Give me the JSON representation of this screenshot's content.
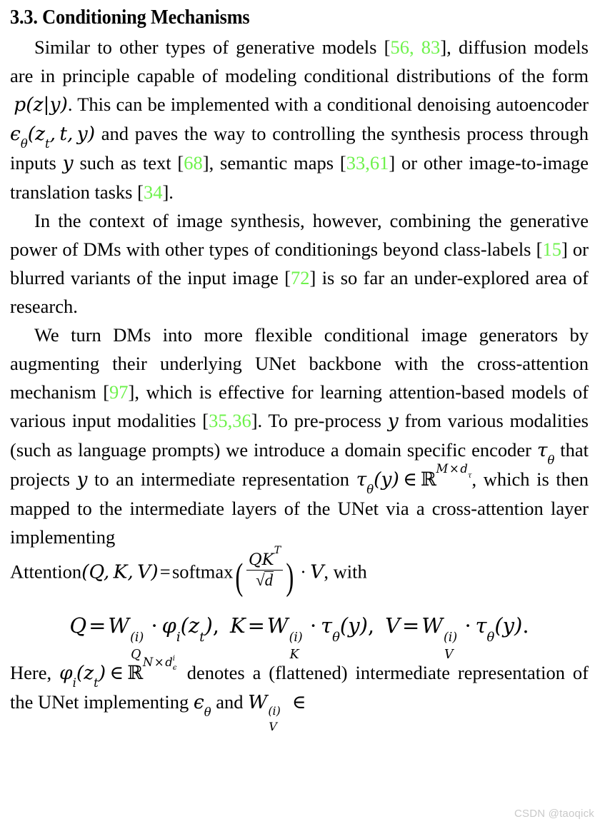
{
  "document": {
    "type": "academic-paper-excerpt",
    "background_color": "#ffffff",
    "text_color": "#000000",
    "citation_color": "#6EF24C"
  },
  "section": {
    "number": "3.3.",
    "title": "3.3. Conditioning Mechanisms"
  },
  "paragraphs": {
    "p1": {
      "s1": "Similar to other types of generative models [",
      "c1": "56, 83",
      "s2": "], diffusion models are in principle capable of modeling conditional distributions of the form ",
      "m1": "p(z|y)",
      "s3": ". This can be implemented with a conditional denoising autoencoder ",
      "m2": "ϵθ(zt, t, y)",
      "s4": " and paves the way to controlling the synthesis process through inputs ",
      "m3": "y",
      "s5": " such as text [",
      "c2": "68",
      "s6": "], semantic maps [",
      "c3": "33",
      "s7": ",",
      "c4": "61",
      "s8": "] or other image-to-image translation tasks [",
      "c5": "34",
      "s9": "]."
    },
    "p2": {
      "s1": "In the context of image synthesis, however, combining the generative power of DMs with other types of conditionings beyond class-labels [",
      "c1": "15",
      "s2": "] or blurred variants of the input image [",
      "c2": "72",
      "s3": "] is so far an under-explored area of research."
    },
    "p3": {
      "s1": "We turn DMs into more flexible conditional image generators by augmenting their underlying UNet backbone with the cross-attention mechanism [",
      "c1": "97",
      "s2": "], which is effective for learning attention-based models of various input modalities [",
      "c2": "35",
      "s3": ",",
      "c3": "36",
      "s4": "]. To pre-process ",
      "m1": "y",
      "s5": " from various modalities (such as language prompts) we introduce a domain specific encoder ",
      "m2": "τθ",
      "s6": " that projects ",
      "m3": "y",
      "s7": " to an intermediate representation ",
      "m4": "τθ(y) ∈ ℝ^{M×dτ}",
      "s8": ", which is then mapped to the intermediate layers of the UNet via a cross-attention layer implementing"
    },
    "p4": {
      "s1": "Here, ",
      "m1": "φi(zt) ∈ ℝ^{N×dϵ^i}",
      "s2": " denotes a (flattened) intermediate representation of the UNet implementing ",
      "m2": "ϵθ",
      "s3": " and ",
      "m3": "WV^(i)",
      "s4": " ∈"
    }
  },
  "math": {
    "attention_line": {
      "label": "Attention",
      "args": "(Q, K, V)",
      "equals": "=",
      "softmax": "softmax",
      "numerator": "QK",
      "numerator_sup": "T",
      "denominator_radicand": "d",
      "dot": "·",
      "result": "V",
      "trailing": ", with"
    },
    "display_equation": {
      "q_lhs": "Q",
      "q_eq": "=",
      "q_w": "W",
      "q_sup": "(i)",
      "q_sub": "Q",
      "q_dot": "·",
      "q_rhs": "φi(zt)",
      "sep1": ",",
      "k_lhs": "K",
      "k_eq": "=",
      "k_w": "W",
      "k_sup": "(i)",
      "k_sub": "K",
      "k_dot": "·",
      "k_rhs": "τθ(y)",
      "sep2": ",",
      "v_lhs": "V",
      "v_eq": "=",
      "v_w": "W",
      "v_sup": "(i)",
      "v_sub": "V",
      "v_dot": "·",
      "v_rhs": "τθ(y)",
      "period": "."
    }
  },
  "watermark": {
    "text": "CSDN @taoqick"
  }
}
